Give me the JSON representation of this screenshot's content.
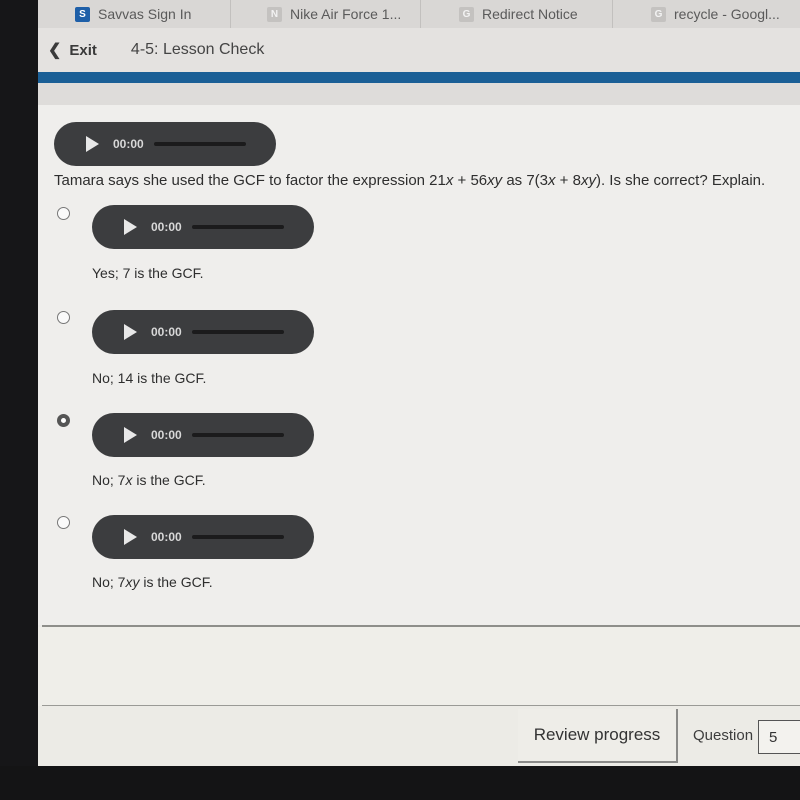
{
  "browser": {
    "tabs": [
      {
        "label": "Savvas Sign In",
        "favicon": "S"
      },
      {
        "label": "Nike Air Force 1...",
        "favicon": "N"
      },
      {
        "label": "Redirect Notice",
        "favicon": "G"
      },
      {
        "label": "recycle - Googl...",
        "favicon": "G"
      }
    ]
  },
  "header": {
    "exit_label": "Exit",
    "lesson_title": "4-5: Lesson Check"
  },
  "colors": {
    "accent_bar": "#1a5f96",
    "audio_player": "#3c3d3f"
  },
  "question": {
    "audio_time": "00:00",
    "text_parts": {
      "a": "Tamara says she used the GCF to factor the expression 21",
      "b": "x",
      "c": " + 56",
      "d": "xy",
      "e": " as 7(3",
      "f": "x",
      "g": " + 8",
      "h": "xy",
      "i": "). Is she correct? Explain."
    }
  },
  "options": [
    {
      "audio_time": "00:00",
      "prefix": "Yes; 7 is the GCF.",
      "var": "",
      "suffix": "",
      "selected": false
    },
    {
      "audio_time": "00:00",
      "prefix": "No; 14 is the GCF.",
      "var": "",
      "suffix": "",
      "selected": false
    },
    {
      "audio_time": "00:00",
      "prefix": "No; 7",
      "var": "x",
      "suffix": " is the GCF.",
      "selected": true
    },
    {
      "audio_time": "00:00",
      "prefix": "No; 7",
      "var": "xy",
      "suffix": " is the GCF.",
      "selected": false
    }
  ],
  "footer": {
    "review_label": "Review progress",
    "question_label": "Question",
    "question_number": "5"
  }
}
